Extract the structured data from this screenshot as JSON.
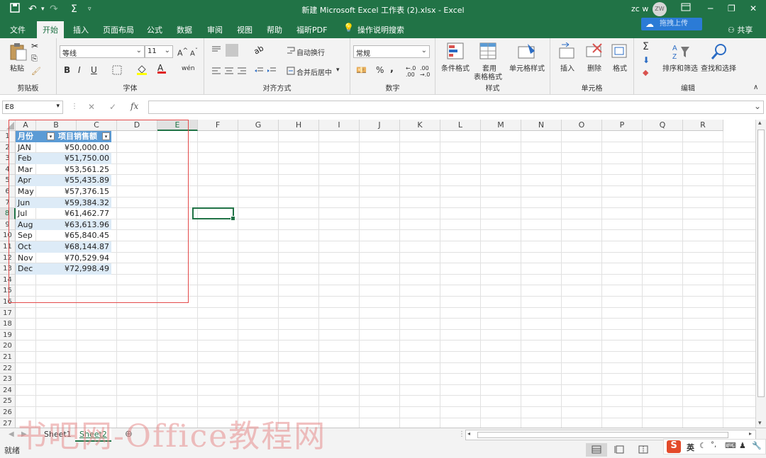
{
  "titlebar": {
    "title": "新建 Microsoft Excel 工作表 (2).xlsx  -  Excel",
    "user": "zc w",
    "avatar": "ZW",
    "undo_icon": "undo-icon",
    "redo_icon": "redo-icon",
    "sum_icon": "sigma-icon"
  },
  "tabs": [
    "文件",
    "开始",
    "插入",
    "页面布局",
    "公式",
    "数据",
    "审阅",
    "视图",
    "帮助",
    "福昕PDF",
    "操作说明搜索"
  ],
  "active_tab": "开始",
  "upload_button": "拖拽上传",
  "share_label": "共享",
  "ribbon": {
    "clipboard": {
      "paste": "粘贴",
      "label": "剪贴板"
    },
    "font": {
      "name": "等线",
      "size": "11",
      "bold": "B",
      "italic": "I",
      "underline": "U",
      "label": "字体"
    },
    "alignment": {
      "wrap": "自动换行",
      "merge": "合并后居中",
      "label": "对齐方式"
    },
    "number": {
      "format": "常规",
      "percent": "%",
      "comma": ",",
      "label": "数字"
    },
    "styles": {
      "conditional": "条件格式",
      "table_line1": "套用",
      "table_line2": "表格格式",
      "cell_style": "单元格样式",
      "label": "样式"
    },
    "cells": {
      "insert": "插入",
      "delete": "删除",
      "format": "格式",
      "label": "单元格"
    },
    "editing": {
      "sort": "排序和筛选",
      "find": "查找和选择",
      "label": "编辑"
    }
  },
  "formula_bar": {
    "name_box": "E8",
    "fx": "fx",
    "value": ""
  },
  "columns": [
    "A",
    "B",
    "C",
    "D",
    "E",
    "F",
    "G",
    "H",
    "I",
    "J",
    "K",
    "L",
    "M",
    "N",
    "O",
    "P",
    "Q",
    "R"
  ],
  "selected_column": "E",
  "selected_row": 8,
  "rows": [
    "1",
    "2",
    "3",
    "4",
    "5",
    "6",
    "7",
    "8",
    "9",
    "10",
    "11",
    "12",
    "13",
    "14",
    "15",
    "16",
    "17",
    "18",
    "19",
    "20",
    "21",
    "22",
    "23",
    "24",
    "25",
    "26",
    "27"
  ],
  "table": {
    "headers": [
      "月份",
      "项目销售额"
    ],
    "rows": [
      [
        "JAN",
        "¥50,000.00"
      ],
      [
        "Feb",
        "¥51,750.00"
      ],
      [
        "Mar",
        "¥53,561.25"
      ],
      [
        "Apr",
        "¥55,435.89"
      ],
      [
        "May",
        "¥57,376.15"
      ],
      [
        "Jun",
        "¥59,384.32"
      ],
      [
        "Jul",
        "¥61,462.77"
      ],
      [
        "Aug",
        "¥63,613.96"
      ],
      [
        "Sep",
        "¥65,840.45"
      ],
      [
        "Oct",
        "¥68,144.87"
      ],
      [
        "Nov",
        "¥70,529.94"
      ],
      [
        "Dec",
        "¥72,998.49"
      ]
    ]
  },
  "sheets": [
    "Sheet1",
    "Sheet2"
  ],
  "active_sheet": "Sheet2",
  "status": {
    "ready": "就绪",
    "ime": "英"
  },
  "watermark": "书吧网-Office教程网",
  "colors": {
    "excel_green": "#217346",
    "table_header": "#5b9bd5",
    "table_band": "#ddebf7",
    "annotation_red": "#e44b4b"
  }
}
